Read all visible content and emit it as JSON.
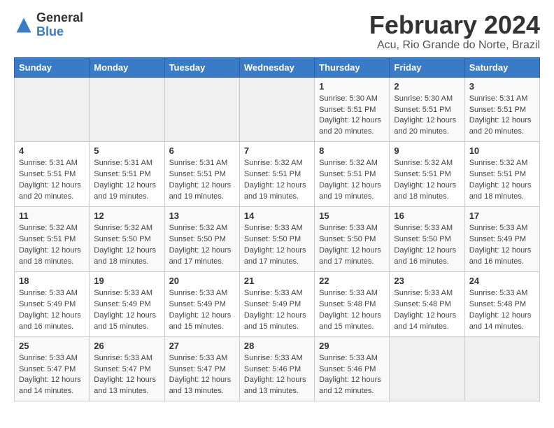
{
  "logo": {
    "general": "General",
    "blue": "Blue"
  },
  "title": "February 2024",
  "location": "Acu, Rio Grande do Norte, Brazil",
  "days_of_week": [
    "Sunday",
    "Monday",
    "Tuesday",
    "Wednesday",
    "Thursday",
    "Friday",
    "Saturday"
  ],
  "weeks": [
    [
      {
        "day": "",
        "info": ""
      },
      {
        "day": "",
        "info": ""
      },
      {
        "day": "",
        "info": ""
      },
      {
        "day": "",
        "info": ""
      },
      {
        "day": "1",
        "info": "Sunrise: 5:30 AM\nSunset: 5:51 PM\nDaylight: 12 hours\nand 20 minutes."
      },
      {
        "day": "2",
        "info": "Sunrise: 5:30 AM\nSunset: 5:51 PM\nDaylight: 12 hours\nand 20 minutes."
      },
      {
        "day": "3",
        "info": "Sunrise: 5:31 AM\nSunset: 5:51 PM\nDaylight: 12 hours\nand 20 minutes."
      }
    ],
    [
      {
        "day": "4",
        "info": "Sunrise: 5:31 AM\nSunset: 5:51 PM\nDaylight: 12 hours\nand 20 minutes."
      },
      {
        "day": "5",
        "info": "Sunrise: 5:31 AM\nSunset: 5:51 PM\nDaylight: 12 hours\nand 19 minutes."
      },
      {
        "day": "6",
        "info": "Sunrise: 5:31 AM\nSunset: 5:51 PM\nDaylight: 12 hours\nand 19 minutes."
      },
      {
        "day": "7",
        "info": "Sunrise: 5:32 AM\nSunset: 5:51 PM\nDaylight: 12 hours\nand 19 minutes."
      },
      {
        "day": "8",
        "info": "Sunrise: 5:32 AM\nSunset: 5:51 PM\nDaylight: 12 hours\nand 19 minutes."
      },
      {
        "day": "9",
        "info": "Sunrise: 5:32 AM\nSunset: 5:51 PM\nDaylight: 12 hours\nand 18 minutes."
      },
      {
        "day": "10",
        "info": "Sunrise: 5:32 AM\nSunset: 5:51 PM\nDaylight: 12 hours\nand 18 minutes."
      }
    ],
    [
      {
        "day": "11",
        "info": "Sunrise: 5:32 AM\nSunset: 5:51 PM\nDaylight: 12 hours\nand 18 minutes."
      },
      {
        "day": "12",
        "info": "Sunrise: 5:32 AM\nSunset: 5:50 PM\nDaylight: 12 hours\nand 18 minutes."
      },
      {
        "day": "13",
        "info": "Sunrise: 5:32 AM\nSunset: 5:50 PM\nDaylight: 12 hours\nand 17 minutes."
      },
      {
        "day": "14",
        "info": "Sunrise: 5:33 AM\nSunset: 5:50 PM\nDaylight: 12 hours\nand 17 minutes."
      },
      {
        "day": "15",
        "info": "Sunrise: 5:33 AM\nSunset: 5:50 PM\nDaylight: 12 hours\nand 17 minutes."
      },
      {
        "day": "16",
        "info": "Sunrise: 5:33 AM\nSunset: 5:50 PM\nDaylight: 12 hours\nand 16 minutes."
      },
      {
        "day": "17",
        "info": "Sunrise: 5:33 AM\nSunset: 5:49 PM\nDaylight: 12 hours\nand 16 minutes."
      }
    ],
    [
      {
        "day": "18",
        "info": "Sunrise: 5:33 AM\nSunset: 5:49 PM\nDaylight: 12 hours\nand 16 minutes."
      },
      {
        "day": "19",
        "info": "Sunrise: 5:33 AM\nSunset: 5:49 PM\nDaylight: 12 hours\nand 15 minutes."
      },
      {
        "day": "20",
        "info": "Sunrise: 5:33 AM\nSunset: 5:49 PM\nDaylight: 12 hours\nand 15 minutes."
      },
      {
        "day": "21",
        "info": "Sunrise: 5:33 AM\nSunset: 5:49 PM\nDaylight: 12 hours\nand 15 minutes."
      },
      {
        "day": "22",
        "info": "Sunrise: 5:33 AM\nSunset: 5:48 PM\nDaylight: 12 hours\nand 15 minutes."
      },
      {
        "day": "23",
        "info": "Sunrise: 5:33 AM\nSunset: 5:48 PM\nDaylight: 12 hours\nand 14 minutes."
      },
      {
        "day": "24",
        "info": "Sunrise: 5:33 AM\nSunset: 5:48 PM\nDaylight: 12 hours\nand 14 minutes."
      }
    ],
    [
      {
        "day": "25",
        "info": "Sunrise: 5:33 AM\nSunset: 5:47 PM\nDaylight: 12 hours\nand 14 minutes."
      },
      {
        "day": "26",
        "info": "Sunrise: 5:33 AM\nSunset: 5:47 PM\nDaylight: 12 hours\nand 13 minutes."
      },
      {
        "day": "27",
        "info": "Sunrise: 5:33 AM\nSunset: 5:47 PM\nDaylight: 12 hours\nand 13 minutes."
      },
      {
        "day": "28",
        "info": "Sunrise: 5:33 AM\nSunset: 5:46 PM\nDaylight: 12 hours\nand 13 minutes."
      },
      {
        "day": "29",
        "info": "Sunrise: 5:33 AM\nSunset: 5:46 PM\nDaylight: 12 hours\nand 12 minutes."
      },
      {
        "day": "",
        "info": ""
      },
      {
        "day": "",
        "info": ""
      }
    ]
  ]
}
